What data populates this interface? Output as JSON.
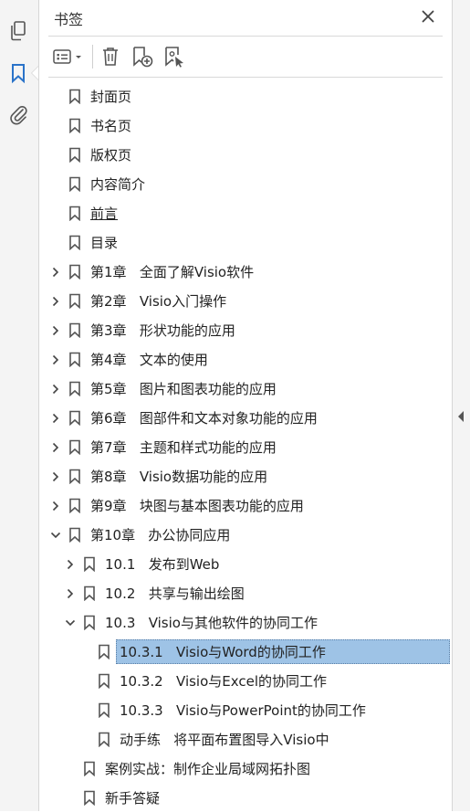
{
  "panel": {
    "title": "书签"
  },
  "left_rail": {
    "icons": [
      "pages-icon",
      "bookmark-icon",
      "attachment-icon"
    ]
  },
  "toolbar": {
    "icons": [
      "options-menu-icon",
      "delete-icon",
      "new-bookmark-icon",
      "bookmark-from-selection-icon"
    ]
  },
  "bookmarks": [
    {
      "label": "封面页",
      "depth": 0,
      "toggle": "none"
    },
    {
      "label": "书名页",
      "depth": 0,
      "toggle": "none"
    },
    {
      "label": "版权页",
      "depth": 0,
      "toggle": "none"
    },
    {
      "label": "内容简介",
      "depth": 0,
      "toggle": "none"
    },
    {
      "label": "前言",
      "depth": 0,
      "toggle": "none",
      "underline": true
    },
    {
      "label": "目录",
      "depth": 0,
      "toggle": "none"
    },
    {
      "label": "第1章   全面了解Visio软件",
      "depth": 0,
      "toggle": "collapsed"
    },
    {
      "label": "第2章   Visio入门操作",
      "depth": 0,
      "toggle": "collapsed"
    },
    {
      "label": "第3章   形状功能的应用",
      "depth": 0,
      "toggle": "collapsed"
    },
    {
      "label": "第4章   文本的使用",
      "depth": 0,
      "toggle": "collapsed"
    },
    {
      "label": "第5章   图片和图表功能的应用",
      "depth": 0,
      "toggle": "collapsed"
    },
    {
      "label": "第6章   图部件和文本对象功能的应用",
      "depth": 0,
      "toggle": "collapsed"
    },
    {
      "label": "第7章   主题和样式功能的应用",
      "depth": 0,
      "toggle": "collapsed"
    },
    {
      "label": "第8章   Visio数据功能的应用",
      "depth": 0,
      "toggle": "collapsed"
    },
    {
      "label": "第9章   块图与基本图表功能的应用",
      "depth": 0,
      "toggle": "collapsed"
    },
    {
      "label": "第10章   办公协同应用",
      "depth": 0,
      "toggle": "expanded"
    },
    {
      "label": "10.1   发布到Web",
      "depth": 1,
      "toggle": "collapsed"
    },
    {
      "label": "10.2   共享与输出绘图",
      "depth": 1,
      "toggle": "collapsed"
    },
    {
      "label": "10.3   Visio与其他软件的协同工作",
      "depth": 1,
      "toggle": "expanded"
    },
    {
      "label": "10.3.1   Visio与Word的协同工作",
      "depth": 2,
      "toggle": "none",
      "selected": true
    },
    {
      "label": "10.3.2   Visio与Excel的协同工作",
      "depth": 2,
      "toggle": "none"
    },
    {
      "label": "10.3.3   Visio与PowerPoint的协同工作",
      "depth": 2,
      "toggle": "none"
    },
    {
      "label": "动手练   将平面布置图导入Visio中",
      "depth": 2,
      "toggle": "none"
    },
    {
      "label": "案例实战：制作企业局域网拓扑图",
      "depth": 1,
      "toggle": "none"
    },
    {
      "label": "新手答疑",
      "depth": 1,
      "toggle": "none"
    }
  ],
  "colors": {
    "selection": "#9ec3e6",
    "icon": "#555555"
  }
}
